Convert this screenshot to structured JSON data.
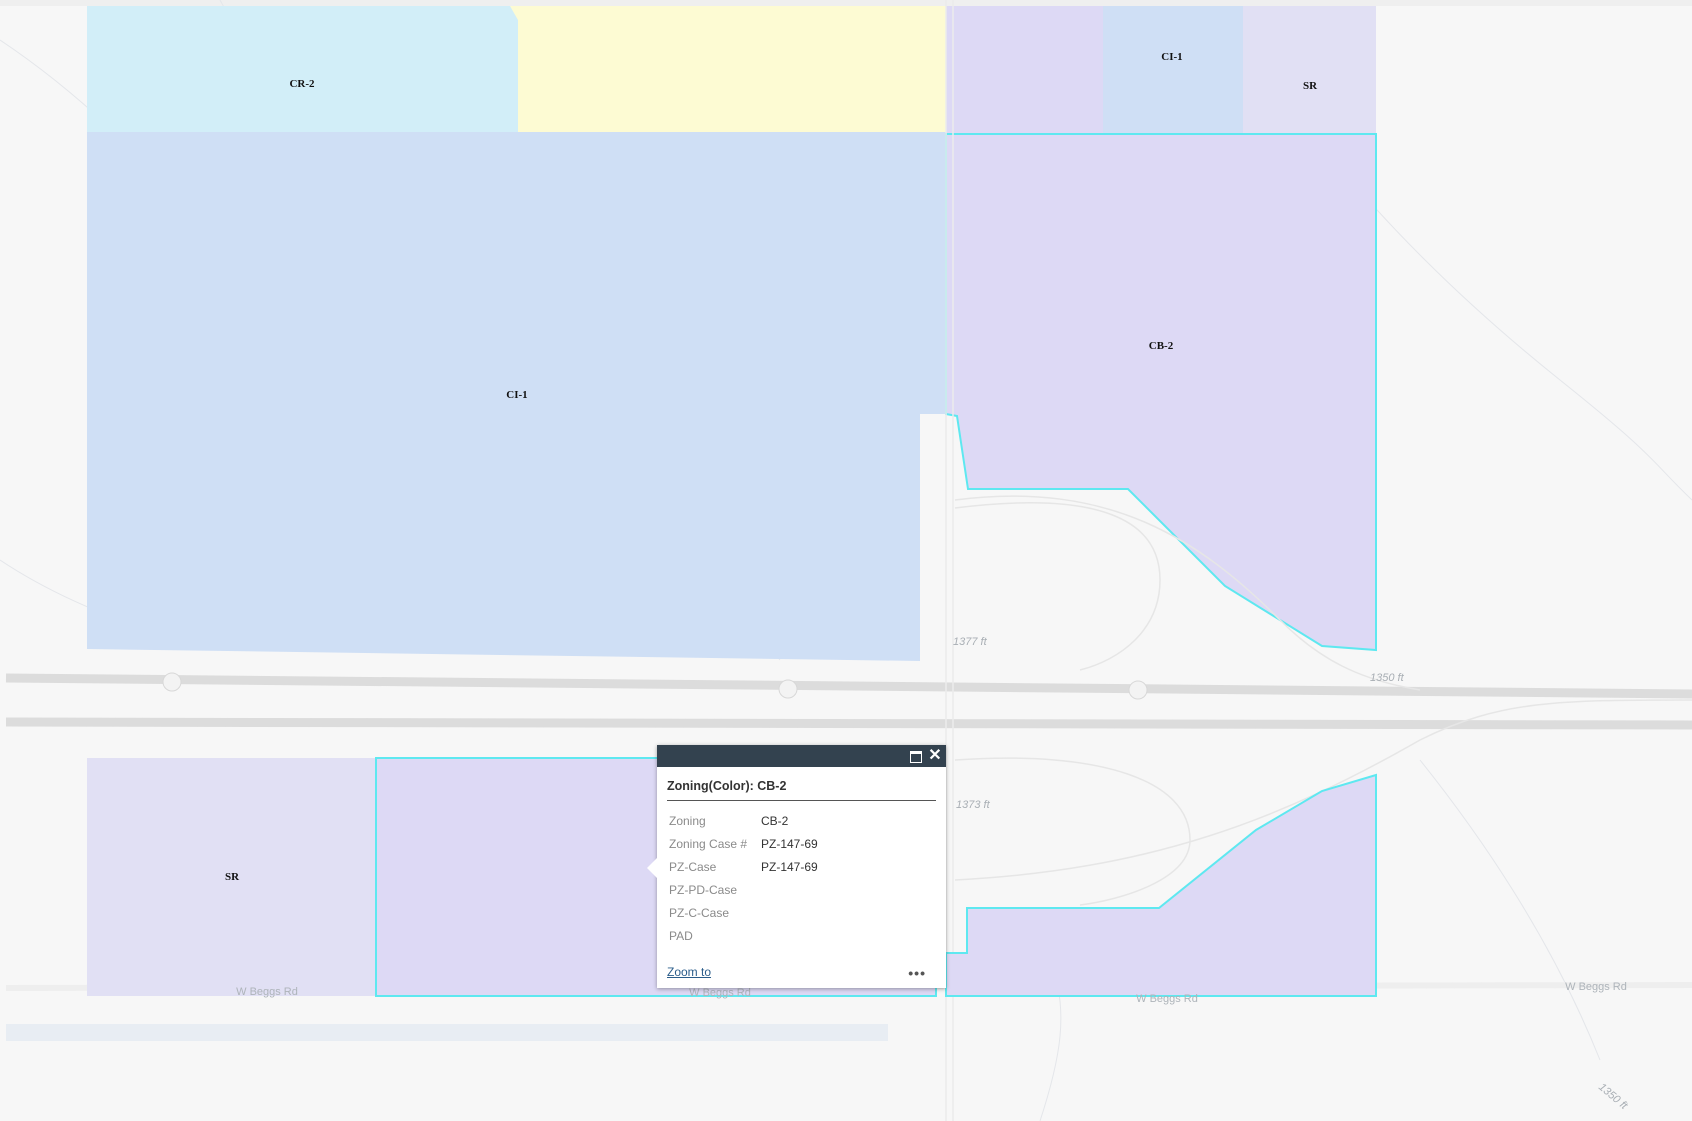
{
  "map": {
    "zones": {
      "cr2_north": "CR-2",
      "ci1_northeast": "CI-1",
      "sr_northeast": "SR",
      "cb2_north": "CB-2",
      "ci1_main": "CI-1",
      "sr_south": "SR"
    },
    "road_labels": {
      "beggs_west": "W Beggs Rd",
      "beggs_center": "W Beggs Rd",
      "beggs_east_center": "W Beggs Rd",
      "beggs_far_east": "W Beggs Rd"
    },
    "elevation_labels": {
      "elev_1377": "1377 ft",
      "elev_1350": "1350 ft",
      "elev_1373": "1373 ft",
      "elev_1350_se": "1350 ft"
    },
    "colors": {
      "ci1": "#cfdff5",
      "cb2": "#ddd9f5",
      "cr2": "#d2eef8",
      "sr": "#e1e0f4",
      "yellow_zone": "#fdfbd3",
      "selection": "#5ee8f0",
      "popup_header": "#33424f"
    }
  },
  "popup": {
    "title": "Zoning(Color): CB-2",
    "attributes": [
      {
        "key": "Zoning",
        "value": "CB-2"
      },
      {
        "key": "Zoning Case #",
        "value": "PZ-147-69"
      },
      {
        "key": "PZ-Case",
        "value": "PZ-147-69"
      },
      {
        "key": "PZ-PD-Case",
        "value": ""
      },
      {
        "key": "PZ-C-Case",
        "value": ""
      },
      {
        "key": "PAD",
        "value": ""
      }
    ],
    "zoom_to_label": "Zoom to",
    "more_label": "•••",
    "close_label": "✕",
    "maximize_icon": "maximize-icon"
  }
}
